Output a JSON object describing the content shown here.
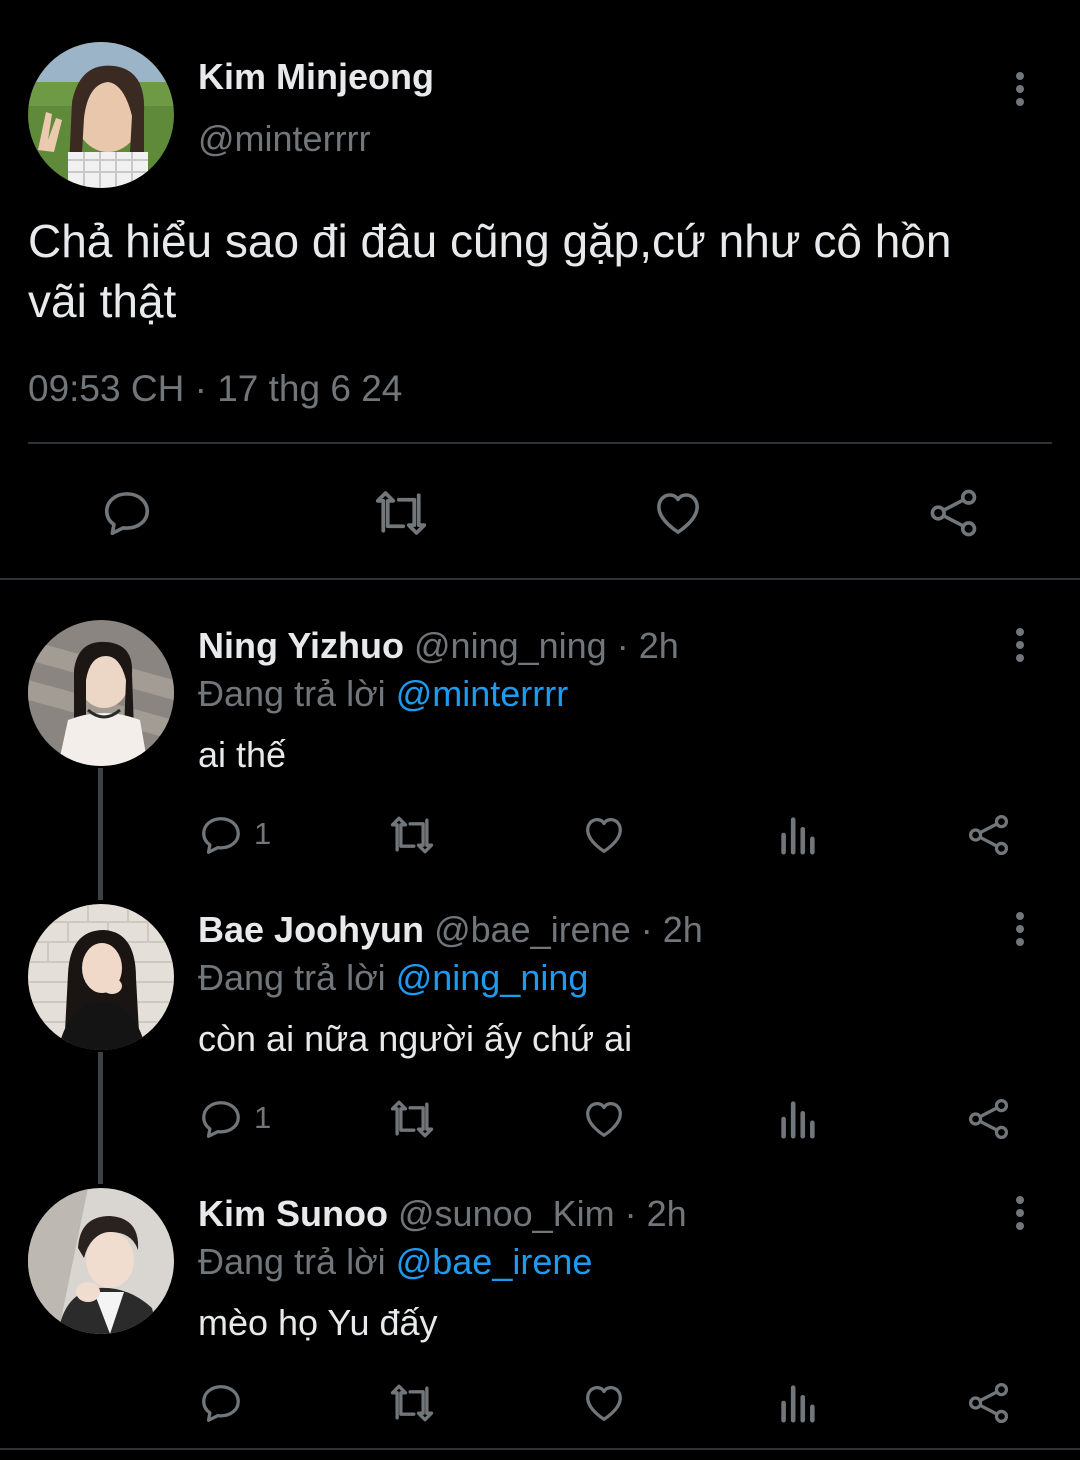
{
  "main_tweet": {
    "display_name": "Kim Minjeong",
    "handle": "@minterrrr",
    "text_line1": "Chả hiểu sao đi đâu cũng gặp,cứ như cô hồn",
    "text_line2": "vãi thật",
    "time": "09:53 CH",
    "separator": "·",
    "date": "17 thg 6 24"
  },
  "replies": [
    {
      "display_name": "Ning Yizhuo",
      "handle": "@ning_ning",
      "age": "· 2h",
      "replying_label": "Đang trả lời",
      "replying_to": "@minterrrr",
      "text": "ai thế",
      "reply_count": "1"
    },
    {
      "display_name": "Bae Joohyun",
      "handle": "@bae_irene",
      "age": "· 2h",
      "replying_label": "Đang trả lời",
      "replying_to": "@ning_ning",
      "text": "còn ai nữa người ấy chứ ai",
      "reply_count": "1"
    },
    {
      "display_name": "Kim Sunoo",
      "handle": "@sunoo_Kim",
      "age": "· 2h",
      "replying_label": "Đang trả lời",
      "replying_to": "@bae_irene",
      "text": "mèo họ Yu đấy",
      "reply_count": ""
    }
  ],
  "icons": {
    "reply": "reply-icon",
    "retweet": "retweet-icon",
    "like": "heart-icon",
    "views": "views-icon",
    "share": "share-icon",
    "more": "more-icon"
  },
  "colors": {
    "background": "#000000",
    "text": "#e7e9ea",
    "muted": "#71767b",
    "link": "#1d9bf0",
    "divider": "#2f3336"
  }
}
